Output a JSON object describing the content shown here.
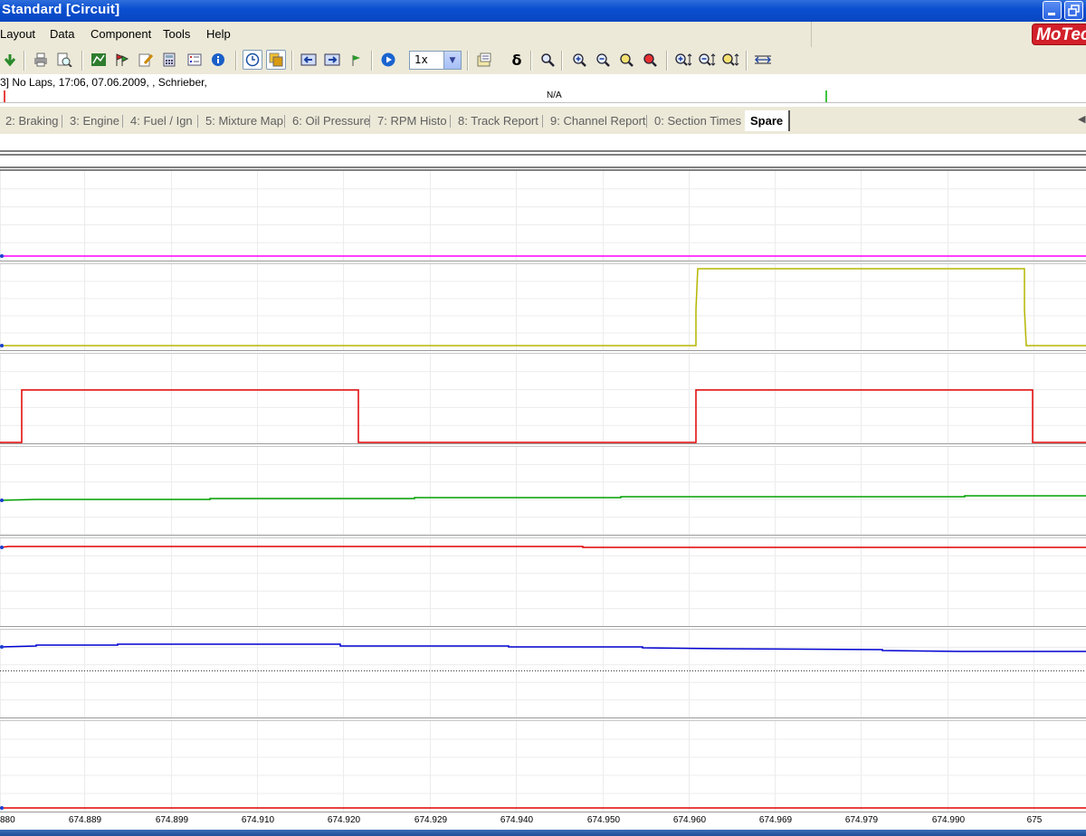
{
  "window": {
    "title": "Standard [Circuit]"
  },
  "menu": [
    "Layout",
    "Data",
    "Component",
    "Tools",
    "Help"
  ],
  "logo": {
    "text": "MoTec"
  },
  "toolbar": {
    "zoom_value": "1x"
  },
  "info": {
    "session": "3] No Laps, 17:06, 07.06.2009, , Schrieber,"
  },
  "lapbar": {
    "label": "N/A"
  },
  "tabs": [
    {
      "label": "2: Braking"
    },
    {
      "label": "3: Engine"
    },
    {
      "label": "4: Fuel / Ign"
    },
    {
      "label": "5: Mixture Map"
    },
    {
      "label": "6: Oil Pressure"
    },
    {
      "label": "7: RPM Histo"
    },
    {
      "label": "8: Track Report"
    },
    {
      "label": "9: Channel Report"
    },
    {
      "label": "0: Section Times"
    },
    {
      "label": "Spare"
    }
  ],
  "active_tab": "Spare",
  "colors": {
    "magenta": "#ff00ff",
    "olive": "#b5b500",
    "red": "#e00000",
    "green": "#00a000",
    "blue": "#0000d0"
  },
  "chart_data": {
    "type": "line",
    "x_ticks": [
      "880",
      "674.889",
      "674.899",
      "674.910",
      "674.920",
      "674.929",
      "674.940",
      "674.950",
      "674.960",
      "674.969",
      "674.979",
      "674.990",
      "675"
    ],
    "series": [
      {
        "color": "#ff00ff",
        "description": "flat"
      },
      {
        "color": "#b5b500",
        "description": "step high from ~674.960 to ~674.998"
      },
      {
        "color": "#e00000",
        "description": "step high from ~674.882 to ~674.921 and ~674.960 to ~674.999"
      },
      {
        "color": "#00a000",
        "description": "slowly rising"
      },
      {
        "color": "#e00000",
        "description": "flat"
      },
      {
        "color": "#0000d0",
        "description": "slowly falling"
      },
      {
        "color": "#e00000",
        "description": "flat near bottom"
      }
    ]
  }
}
